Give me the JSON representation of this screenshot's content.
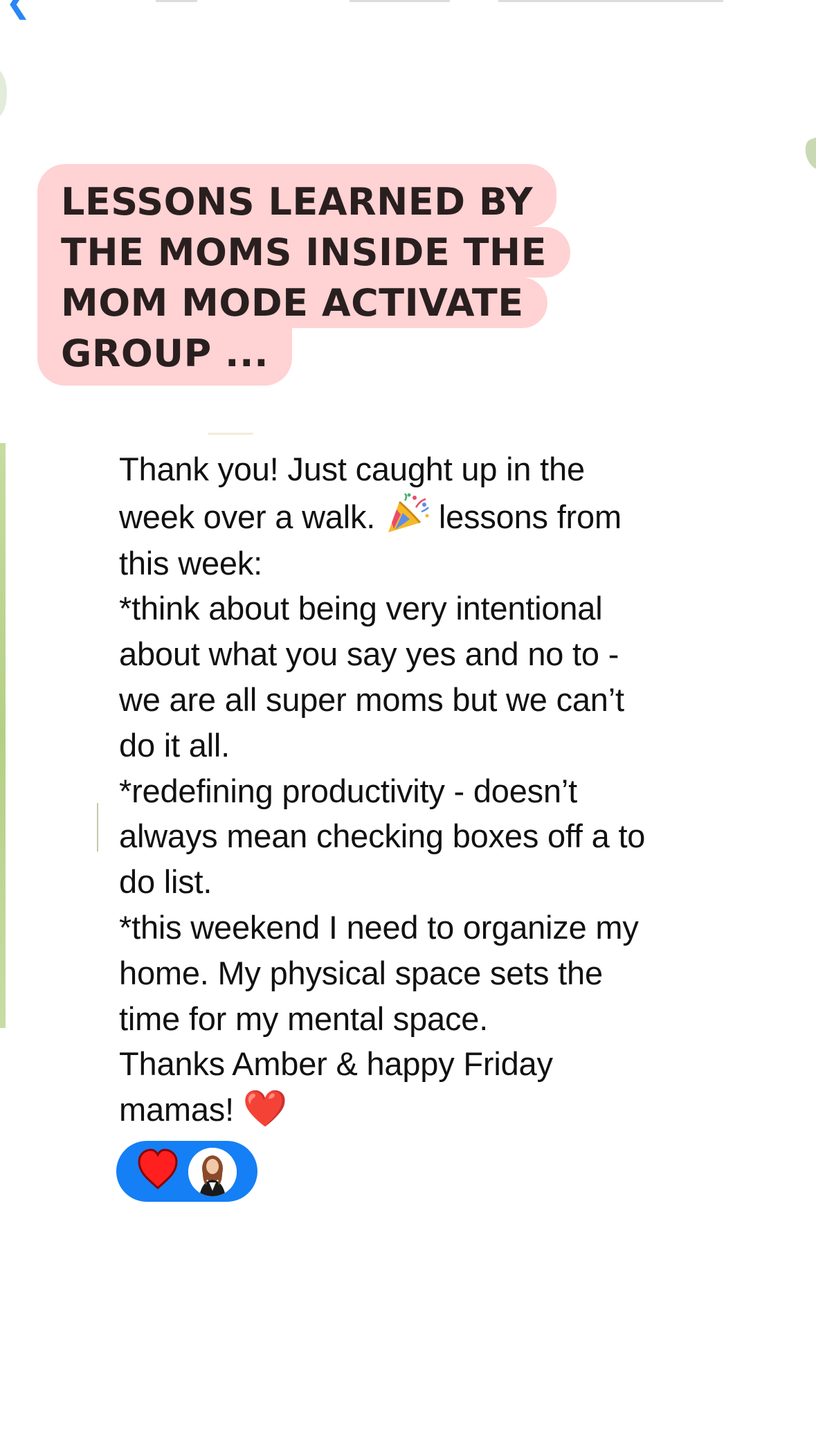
{
  "top": {
    "back_glyph": "❮"
  },
  "title": {
    "lines": [
      "LESSONS LEARNED BY",
      "THE MOMS INSIDE THE",
      "MOM MODE ACTIVATE",
      "GROUP ..."
    ],
    "highlight_color": "#ffd2d3"
  },
  "message": {
    "lines": [
      "Thank you! Just caught up in the",
      "week over a walk.",
      "lessons from",
      "this week:",
      "*think about being very intentional",
      "about what you say yes and no to -",
      "we are all super moms but we can’t",
      "do it all.",
      "*redefining productivity - doesn’t",
      "always mean checking boxes off a to",
      "do list.",
      "*this weekend I need to organize my",
      "home. My physical space sets the",
      "time for my mental space.",
      "Thanks Amber & happy Friday",
      "mamas!"
    ],
    "party_emoji": "party-popper",
    "heart_emoji": "❤️"
  },
  "reaction": {
    "type": "heart",
    "color": "#157ff5",
    "avatar": "user-avatar"
  }
}
